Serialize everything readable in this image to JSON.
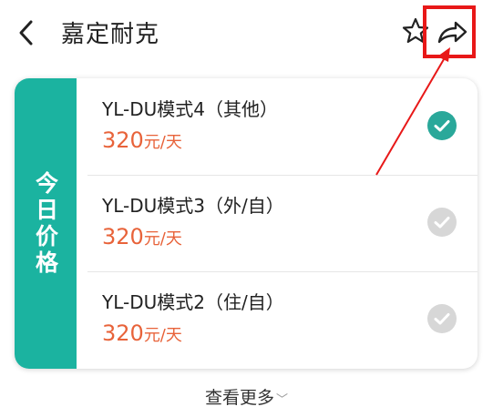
{
  "header": {
    "title": "嘉定耐克",
    "back_icon": "chevron-left-icon",
    "favorite_icon": "star-outline-icon",
    "share_icon": "share-arrow-icon"
  },
  "card": {
    "sidebar_label": "今日价格",
    "accent_color": "#1bb3a0",
    "items": [
      {
        "name": "YL-DU模式4（其他）",
        "price": "320",
        "unit": "元/天",
        "selected": true
      },
      {
        "name": "YL-DU模式3（外/自）",
        "price": "320",
        "unit": "元/天",
        "selected": false
      },
      {
        "name": "YL-DU模式2（住/自）",
        "price": "320",
        "unit": "元/天",
        "selected": false
      }
    ]
  },
  "footer": {
    "more_label": "查看更多",
    "more_icon": "chevron-down-icon"
  },
  "annotation": {
    "highlight_color": "#e81818"
  }
}
